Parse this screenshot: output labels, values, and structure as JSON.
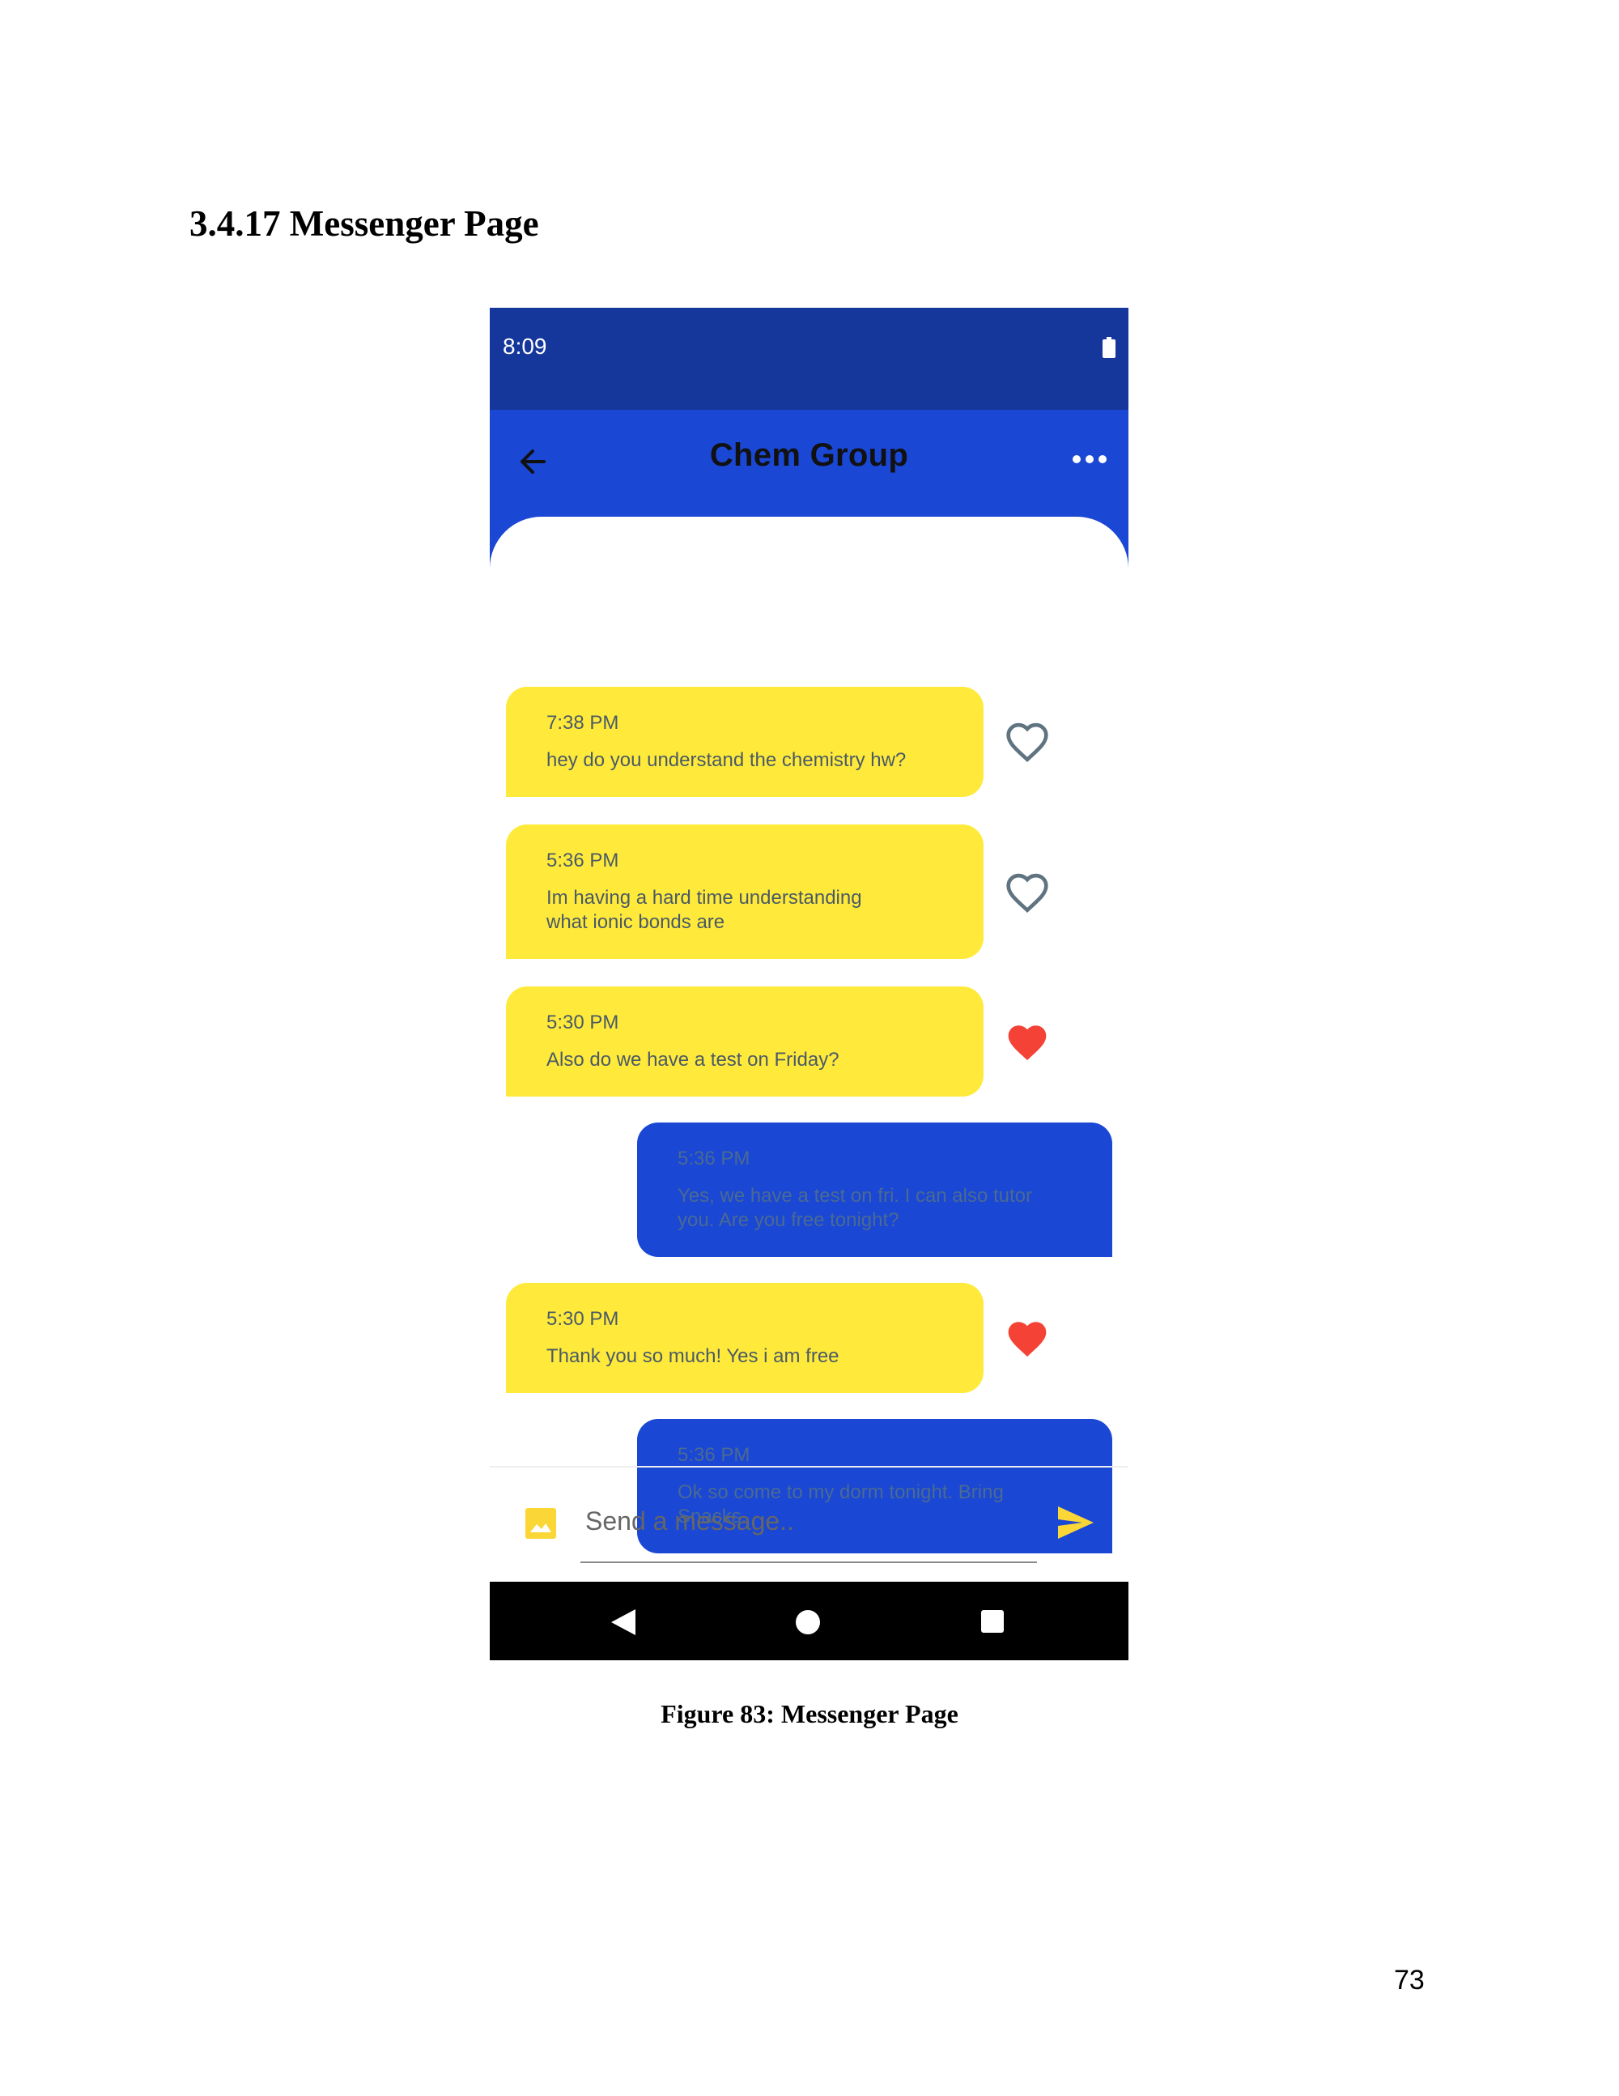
{
  "document": {
    "section_heading": "3.4.17 Messenger Page",
    "figure_caption": "Figure 83: Messenger Page",
    "page_number": "73"
  },
  "status_bar": {
    "time": "8:09",
    "battery_icon": "battery-full-icon"
  },
  "app_bar": {
    "title": "Chem Group",
    "back_icon": "arrow-left-icon",
    "menu_icon": "more-horizontal-icon"
  },
  "messages": [
    {
      "direction": "incoming",
      "time": "7:38 PM",
      "text": "hey do you understand the chemistry hw?",
      "liked": false
    },
    {
      "direction": "incoming",
      "time": "5:36 PM",
      "text": "Im having a hard time understanding what ionic bonds are",
      "liked": false
    },
    {
      "direction": "incoming",
      "time": "5:30 PM",
      "text": "Also do we have a test on Friday?",
      "liked": true
    },
    {
      "direction": "outgoing",
      "time": "5:36 PM",
      "text": "Yes, we have a test on fri. I can also tutor you. Are you free tonight?"
    },
    {
      "direction": "incoming",
      "time": "5:30 PM",
      "text": "Thank you so much! Yes i am free",
      "liked": true
    },
    {
      "direction": "outgoing",
      "time": "5:36 PM",
      "text": "Ok so come to my dorm tonight. Bring Snacks."
    }
  ],
  "composer": {
    "placeholder": "Send a message..",
    "value": "",
    "image_icon": "image-icon",
    "send_icon": "send-icon"
  },
  "nav_bar": {
    "back_icon": "triangle-back-icon",
    "home_icon": "circle-home-icon",
    "recents_icon": "square-recents-icon"
  },
  "colors": {
    "status_bar": "#15379b",
    "app_bar": "#1a47d4",
    "incoming_bubble": "#ffea3b",
    "outgoing_bubble": "#1a47d4",
    "heart_liked": "#f44336",
    "heart_outline": "#5f7480",
    "accent": "#fbd637"
  }
}
